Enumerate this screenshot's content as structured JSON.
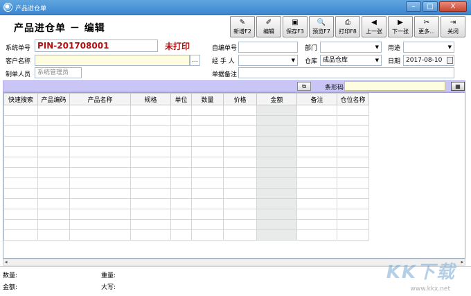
{
  "window": {
    "title": "产品进仓单",
    "minimize": "–",
    "restore": "□",
    "close": "X"
  },
  "form_title": "产品进仓单 － 编辑",
  "toolbar": [
    {
      "name": "new",
      "label": "新增F2",
      "icon": "new-doc-icon",
      "glyph": "✎"
    },
    {
      "name": "edit",
      "label": "编辑",
      "icon": "edit-icon",
      "glyph": "✐"
    },
    {
      "name": "save",
      "label": "保存F3",
      "icon": "save-icon",
      "glyph": "▣"
    },
    {
      "name": "preview",
      "label": "预览F7",
      "icon": "preview-icon",
      "glyph": "🔍"
    },
    {
      "name": "print",
      "label": "打印F8",
      "icon": "printer-icon",
      "glyph": "⎙"
    },
    {
      "name": "prev",
      "label": "上一张",
      "icon": "arrow-left-icon",
      "glyph": "◀"
    },
    {
      "name": "next",
      "label": "下一张",
      "icon": "arrow-right-icon",
      "glyph": "▶"
    },
    {
      "name": "more",
      "label": "更多...",
      "icon": "more-icon",
      "glyph": "✂"
    },
    {
      "name": "close",
      "label": "关闭",
      "icon": "exit-icon",
      "glyph": "⇥"
    }
  ],
  "fields": {
    "system_no_label": "系统单号",
    "system_no": "PIN-201708001",
    "print_status": "未打印",
    "customer_label": "客户名称",
    "customer_value": "",
    "customer_browse": "...",
    "maker_label": "制单人员",
    "maker_placeholder": "系统管理员",
    "self_no_label": "自编单号",
    "self_no_value": "",
    "handler_label": "经 手 人",
    "handler_value": "",
    "doc_note_label": "单据备注",
    "doc_note_value": "",
    "dept_label": "部门",
    "dept_value": "",
    "warehouse_label": "仓库",
    "warehouse_value": "成品仓库",
    "usage_label": "用途",
    "usage_value": "",
    "date_label": "日期",
    "date_value": "2017-08-10"
  },
  "barcode": {
    "label": "条形码",
    "value": ""
  },
  "grid": {
    "columns": [
      "快速搜索",
      "产品编码",
      "产品名称",
      "规格",
      "单位",
      "数量",
      "价格",
      "金额",
      "备注",
      "仓位名称"
    ],
    "row_count": 13
  },
  "footer": {
    "qty_label": "数量:",
    "weight_label": "重量:",
    "amount_label": "金额:",
    "uppercase_label": "大写:"
  },
  "watermark": {
    "text": "KK下载",
    "url": "www.kkx.net"
  }
}
